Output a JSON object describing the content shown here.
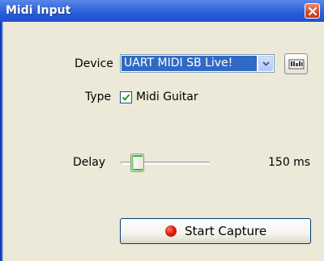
{
  "window": {
    "title": "Midi Input"
  },
  "device": {
    "label": "Device",
    "selected": "UART MIDI SB Live!"
  },
  "type": {
    "label": "Type",
    "checkbox_label": "Midi Guitar",
    "checked": true
  },
  "delay": {
    "label": "Delay",
    "value_text": "150 ms"
  },
  "actions": {
    "start_capture": "Start Capture"
  },
  "colors": {
    "titlebar": "#2457d6",
    "selection": "#316ac5",
    "panel": "#ece9d8",
    "record": "#e02010"
  }
}
